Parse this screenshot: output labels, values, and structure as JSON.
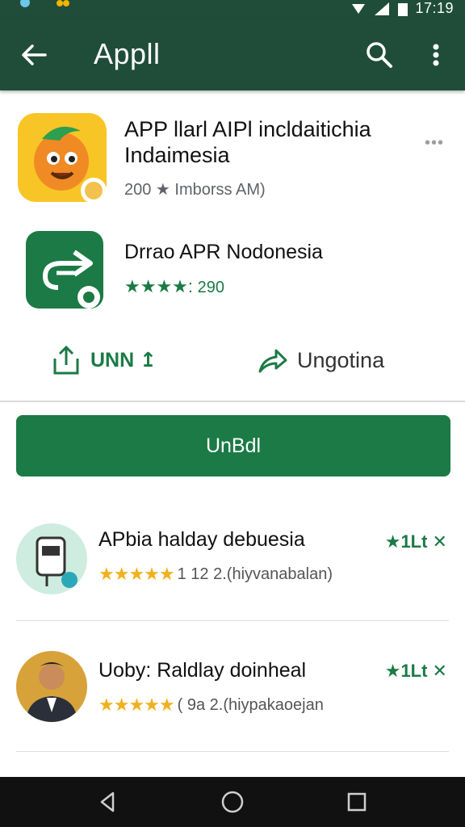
{
  "status_bar": {
    "time": "17:19"
  },
  "app_bar": {
    "title": "Appll"
  },
  "apps": [
    {
      "title_line1": "APP llarl AIPl incldaitichia",
      "title_line2": "Indaimesia",
      "meta": "200 ★ Imborss AM)"
    },
    {
      "title": "Drrao APR Nodonesia",
      "stars": "★★★★:",
      "count": "290"
    }
  ],
  "actions": {
    "left_label": "UNN ↥",
    "right_label": "Ungotina"
  },
  "primary_button": {
    "label": "UnBdl"
  },
  "list": [
    {
      "title": "APbia halday debuesia",
      "stars": "★★★★★",
      "meta": "1 12 2.(hiyvanabalan)",
      "badge": "★1Lt ✕"
    },
    {
      "title": "Uoby: Raldlay doinheal",
      "stars": "★★★★★",
      "meta": "( 9a 2.(hiypakaoejan",
      "badge": "★1Lt ✕"
    }
  ],
  "colors": {
    "app_bar": "#1f4d3a",
    "accent": "#1b7a45",
    "star": "#f2b01e"
  }
}
